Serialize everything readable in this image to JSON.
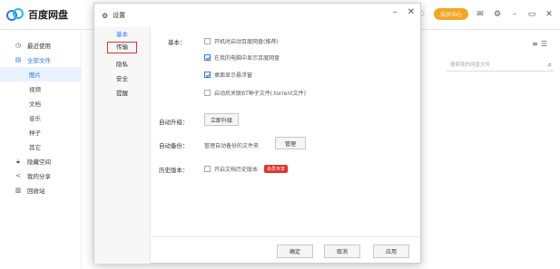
{
  "app": {
    "title": "百度网盘",
    "vip_center": "会员中心",
    "icons": [
      "mail-icon",
      "gear-icon",
      "minimize-icon",
      "maximize-icon",
      "close-icon"
    ]
  },
  "sidebar": {
    "items": [
      {
        "label": "最近使用",
        "icon": "clock-icon"
      },
      {
        "label": "全部文件",
        "icon": "folder-icon"
      },
      {
        "label": "图片"
      },
      {
        "label": "视频"
      },
      {
        "label": "文档"
      },
      {
        "label": "音乐"
      },
      {
        "label": "种子"
      },
      {
        "label": "其它"
      },
      {
        "label": "隐藏空间",
        "icon": "lock-icon"
      },
      {
        "label": "我的分享",
        "icon": "share-icon"
      },
      {
        "label": "回收站",
        "icon": "trash-icon"
      }
    ]
  },
  "content": {
    "search_placeholder": "搜索我的网盘文件"
  },
  "dialog": {
    "title": "设置",
    "nav": [
      "基本",
      "传输",
      "隐私",
      "安全",
      "提醒"
    ],
    "basic": {
      "label": "基本：",
      "options": [
        {
          "text": "开机时启动百度网盘(推荐)",
          "checked": false
        },
        {
          "text": "在我的电脑中显示百度网盘",
          "checked": true
        },
        {
          "text": "桌面显示悬浮窗",
          "checked": true
        },
        {
          "text": "启动后关联BT种子文件(.torrent文件)",
          "checked": false
        }
      ]
    },
    "auto_upgrade": {
      "label": "自动升级：",
      "button": "立即升级"
    },
    "auto_backup": {
      "label": "自动备份：",
      "desc": "管理自动备份的文件夹",
      "button": "管理"
    },
    "history": {
      "label": "历史版本：",
      "option": "开启文档历史版本",
      "badge": "会员专享"
    },
    "footer": {
      "ok": "确定",
      "cancel": "取消",
      "apply": "应用"
    }
  }
}
